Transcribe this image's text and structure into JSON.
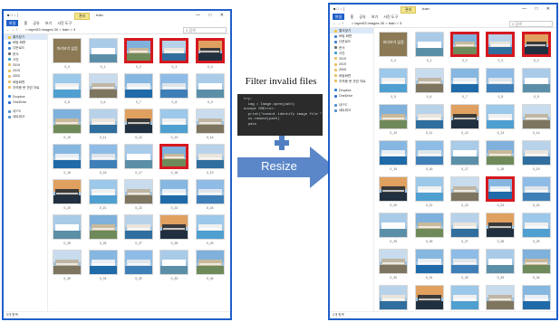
{
  "colors": {
    "window_border": "#1f5fc8",
    "highlight": "#d6181f",
    "arrow": "#5b87c9",
    "plus": "#4f7fc2",
    "code_bg": "#2b2b2b"
  },
  "explorer_left": {
    "titlebar": {
      "icons": "■ □ ↓ │",
      "tab": "관리",
      "title": "train",
      "controls": "— □ ✕"
    },
    "ribbon": {
      "file": "파일",
      "tabs": [
        "홈",
        "공유",
        "보기",
        "사진 도구"
      ]
    },
    "address": {
      "nav": "← → ↑",
      "path": "> layer53 images 30 > train > 3",
      "search": "3 검색"
    },
    "sidebar": [
      {
        "label": "즐겨찾기",
        "icon": "star-icon"
      },
      {
        "label": "바탕 화면",
        "icon": "desktop-icon"
      },
      {
        "label": "다운로드",
        "icon": "download-icon"
      },
      {
        "label": "문서",
        "icon": "document-icon"
      },
      {
        "label": "사진",
        "icon": "picture-icon"
      },
      {
        "label": "2019",
        "icon": "folder-icon"
      },
      {
        "label": "2019",
        "icon": "folder-icon"
      },
      {
        "label": "ZIBS",
        "icon": "folder-icon"
      },
      {
        "label": "바탕화면",
        "icon": "folder-icon"
      },
      {
        "label": "자격증 봇 관련 자료",
        "icon": "folder-icon"
      },
      {
        "label": "Dropbox",
        "icon": "dropbox-icon"
      },
      {
        "label": "OneDrive",
        "icon": "onedrive-icon"
      },
      {
        "label": "내 PC",
        "icon": "pc-icon"
      },
      {
        "label": "네트워크",
        "icon": "network-icon"
      }
    ],
    "status": "5개 항목",
    "thumbnails": [
      {
        "caption": "0_0",
        "state": "placeholder",
        "text": "미리보기 없음"
      },
      {
        "caption": "0_1",
        "state": "normal"
      },
      {
        "caption": "0_2",
        "state": "invalid"
      },
      {
        "caption": "0_3",
        "state": "invalid"
      },
      {
        "caption": "0_4",
        "state": "invalid"
      },
      {
        "caption": "0_5",
        "state": "normal"
      },
      {
        "caption": "0_6",
        "state": "normal"
      },
      {
        "caption": "0_7",
        "state": "normal"
      },
      {
        "caption": "0_8",
        "state": "normal"
      },
      {
        "caption": "0_9",
        "state": "normal"
      },
      {
        "caption": "0_10",
        "state": "normal"
      },
      {
        "caption": "0_11",
        "state": "normal"
      },
      {
        "caption": "0_12",
        "state": "normal"
      },
      {
        "caption": "0_13",
        "state": "normal"
      },
      {
        "caption": "0_14",
        "state": "normal"
      },
      {
        "caption": "0_15",
        "state": "normal"
      },
      {
        "caption": "0_16",
        "state": "normal"
      },
      {
        "caption": "0_17",
        "state": "normal"
      },
      {
        "caption": "0_18",
        "state": "selected"
      },
      {
        "caption": "0_19",
        "state": "normal"
      },
      {
        "caption": "0_20",
        "state": "normal"
      },
      {
        "caption": "0_21",
        "state": "normal"
      },
      {
        "caption": "0_22",
        "state": "normal"
      },
      {
        "caption": "0_23",
        "state": "normal"
      },
      {
        "caption": "0_24",
        "state": "normal"
      },
      {
        "caption": "0_25",
        "state": "normal"
      },
      {
        "caption": "0_26",
        "state": "normal"
      },
      {
        "caption": "0_27",
        "state": "normal"
      },
      {
        "caption": "0_28",
        "state": "normal"
      },
      {
        "caption": "0_29",
        "state": "normal"
      },
      {
        "caption": "0_30",
        "state": "normal"
      },
      {
        "caption": "0_31",
        "state": "normal"
      },
      {
        "caption": "0_32",
        "state": "normal"
      },
      {
        "caption": "0_33",
        "state": "normal"
      },
      {
        "caption": "0_34",
        "state": "normal"
      }
    ]
  },
  "explorer_right": {
    "titlebar": {
      "icons": "■ □ ↓ │",
      "tab": "관리",
      "title": "train",
      "controls": "— □ ✕"
    },
    "ribbon": {
      "file": "파일",
      "tabs": [
        "홈",
        "공유",
        "보기",
        "사진 도구"
      ]
    },
    "address": {
      "nav": "← → ↑",
      "path": "> layer53 images 30 > train > 3",
      "search": "3 검색"
    },
    "sidebar": [
      {
        "label": "즐겨찾기",
        "icon": "star-icon"
      },
      {
        "label": "바탕 화면",
        "icon": "desktop-icon"
      },
      {
        "label": "다운로드",
        "icon": "download-icon"
      },
      {
        "label": "문서",
        "icon": "document-icon"
      },
      {
        "label": "사진",
        "icon": "picture-icon"
      },
      {
        "label": "2019",
        "icon": "folder-icon"
      },
      {
        "label": "2019",
        "icon": "folder-icon"
      },
      {
        "label": "ZIBS",
        "icon": "folder-icon"
      },
      {
        "label": "바탕화면",
        "icon": "folder-icon"
      },
      {
        "label": "자격증 봇 관련 자료",
        "icon": "folder-icon"
      },
      {
        "label": "Dropbox",
        "icon": "dropbox-icon"
      },
      {
        "label": "OneDrive",
        "icon": "onedrive-icon"
      },
      {
        "label": "내 PC",
        "icon": "pc-icon"
      },
      {
        "label": "네트워크",
        "icon": "network-icon"
      }
    ],
    "status": "2개 항목",
    "thumbnails": [
      {
        "caption": "0_0",
        "state": "placeholder",
        "text": "미리보기 없음"
      },
      {
        "caption": "0_1",
        "state": "normal"
      },
      {
        "caption": "0_2",
        "state": "selected"
      },
      {
        "caption": "0_3",
        "state": "selected"
      },
      {
        "caption": "0_4",
        "state": "selected"
      },
      {
        "caption": "0_5",
        "state": "normal"
      },
      {
        "caption": "0_6",
        "state": "normal"
      },
      {
        "caption": "0_7",
        "state": "normal"
      },
      {
        "caption": "0_8",
        "state": "normal"
      },
      {
        "caption": "0_9",
        "state": "normal"
      },
      {
        "caption": "0_10",
        "state": "normal"
      },
      {
        "caption": "0_11",
        "state": "normal"
      },
      {
        "caption": "0_12",
        "state": "normal"
      },
      {
        "caption": "0_13",
        "state": "normal"
      },
      {
        "caption": "0_14",
        "state": "normal"
      },
      {
        "caption": "0_15",
        "state": "normal"
      },
      {
        "caption": "0_16",
        "state": "normal"
      },
      {
        "caption": "0_17",
        "state": "normal"
      },
      {
        "caption": "0_18",
        "state": "normal"
      },
      {
        "caption": "0_19",
        "state": "normal"
      },
      {
        "caption": "0_20",
        "state": "normal"
      },
      {
        "caption": "0_21",
        "state": "normal"
      },
      {
        "caption": "0_22",
        "state": "normal"
      },
      {
        "caption": "0_23",
        "state": "selected"
      },
      {
        "caption": "0_24",
        "state": "normal"
      },
      {
        "caption": "0_25",
        "state": "normal"
      },
      {
        "caption": "0_26",
        "state": "normal"
      },
      {
        "caption": "0_27",
        "state": "normal"
      },
      {
        "caption": "0_28",
        "state": "normal"
      },
      {
        "caption": "0_29",
        "state": "normal"
      },
      {
        "caption": "0_30",
        "state": "normal"
      },
      {
        "caption": "0_31",
        "state": "normal"
      },
      {
        "caption": "0_32",
        "state": "normal"
      },
      {
        "caption": "0_33",
        "state": "normal"
      },
      {
        "caption": "0_34",
        "state": "normal"
      },
      {
        "caption": "0_35",
        "state": "normal"
      },
      {
        "caption": "0_36",
        "state": "normal"
      },
      {
        "caption": "0_37",
        "state": "normal"
      },
      {
        "caption": "0_38",
        "state": "normal"
      },
      {
        "caption": "0_39",
        "state": "normal"
      }
    ]
  },
  "annotations": {
    "filter_title": "Filter invalid files",
    "code_lines": [
      "try:",
      "  img = Image.open(path)",
      "except OSError:",
      "  print(\"cannot identify image file \" + path)",
      "  os.remove(path)",
      "  pass"
    ],
    "arrow_label": "Resize"
  }
}
